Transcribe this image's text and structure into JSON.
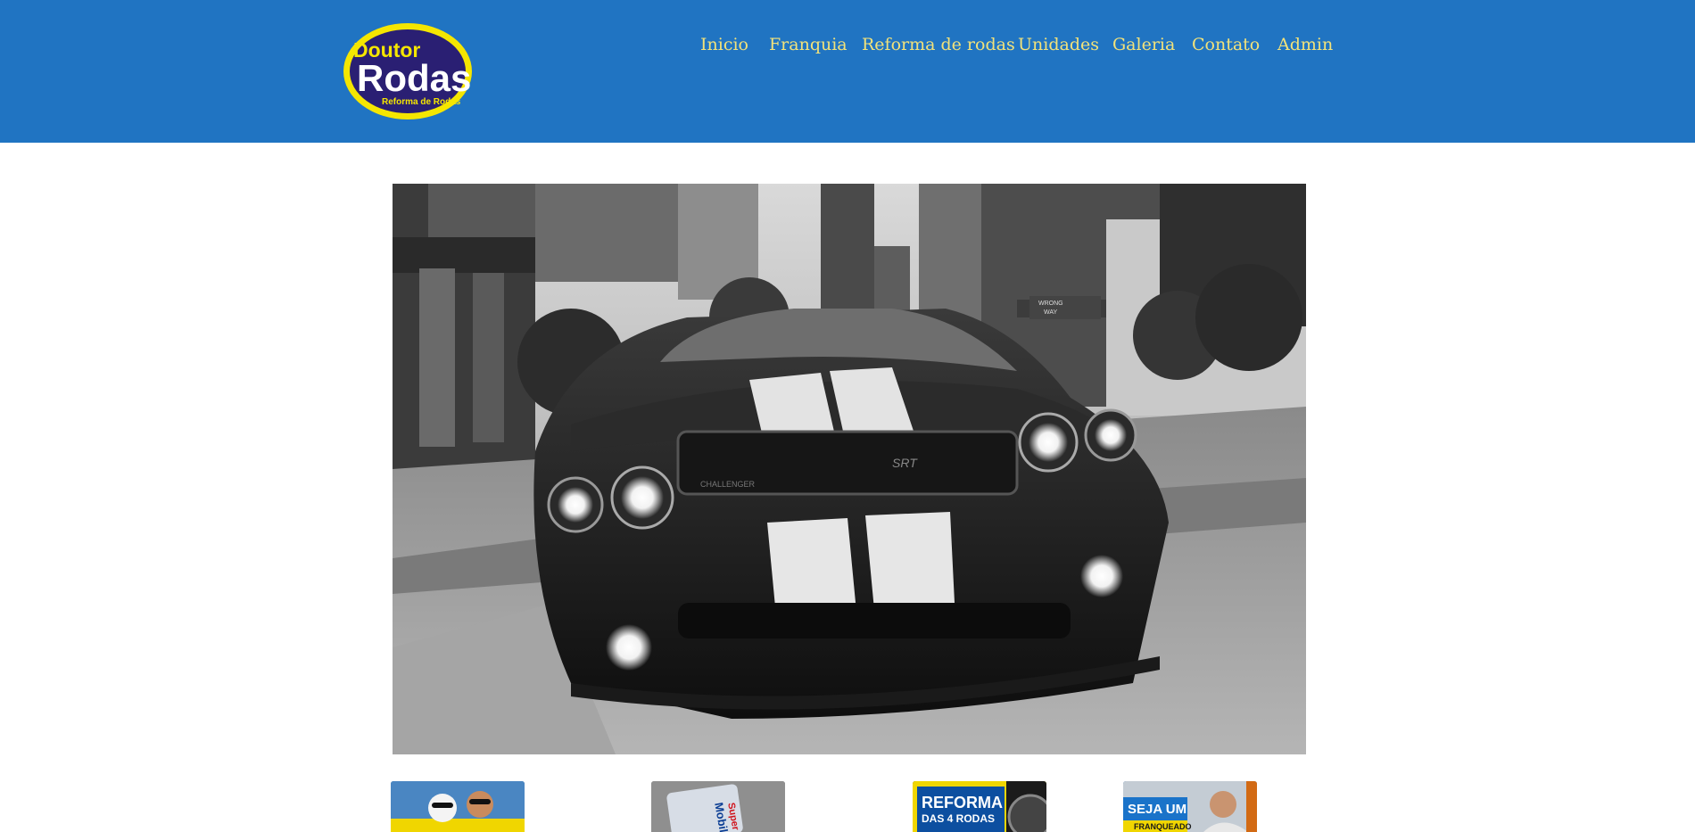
{
  "brand": {
    "logo_line1": "Doutor",
    "logo_line2": "Rodas",
    "logo_tagline": "Reforma de Rodas",
    "colors": {
      "header_bg": "#2074c2",
      "nav_text": "#f2e27a",
      "logo_fill": "#2a1f73",
      "logo_ring": "#f5e600"
    }
  },
  "nav": {
    "items": [
      {
        "label": "Inicio"
      },
      {
        "label": "Franquia"
      },
      {
        "label": "Reforma de rodas"
      },
      {
        "label": "Unidades"
      },
      {
        "label": "Galeria"
      },
      {
        "label": "Contato"
      },
      {
        "label": "Admin"
      }
    ]
  },
  "hero": {
    "signs": [
      "WRONG",
      "WAY"
    ],
    "grille_text": "SRT",
    "badge": "CHALLENGER"
  },
  "thumbnails": {
    "items": [
      {
        "icon": "dog-with-sunglasses-photo"
      },
      {
        "icon": "mobil-super-oil-bottle",
        "text": [
          "Mobil",
          "Super"
        ]
      },
      {
        "icon": "reforma-banner",
        "text": [
          "REFORMA",
          "DAS 4 RODAS"
        ]
      },
      {
        "icon": "franchise-banner",
        "text": [
          "SEJA UM",
          "FRANQUEADO"
        ]
      }
    ]
  }
}
